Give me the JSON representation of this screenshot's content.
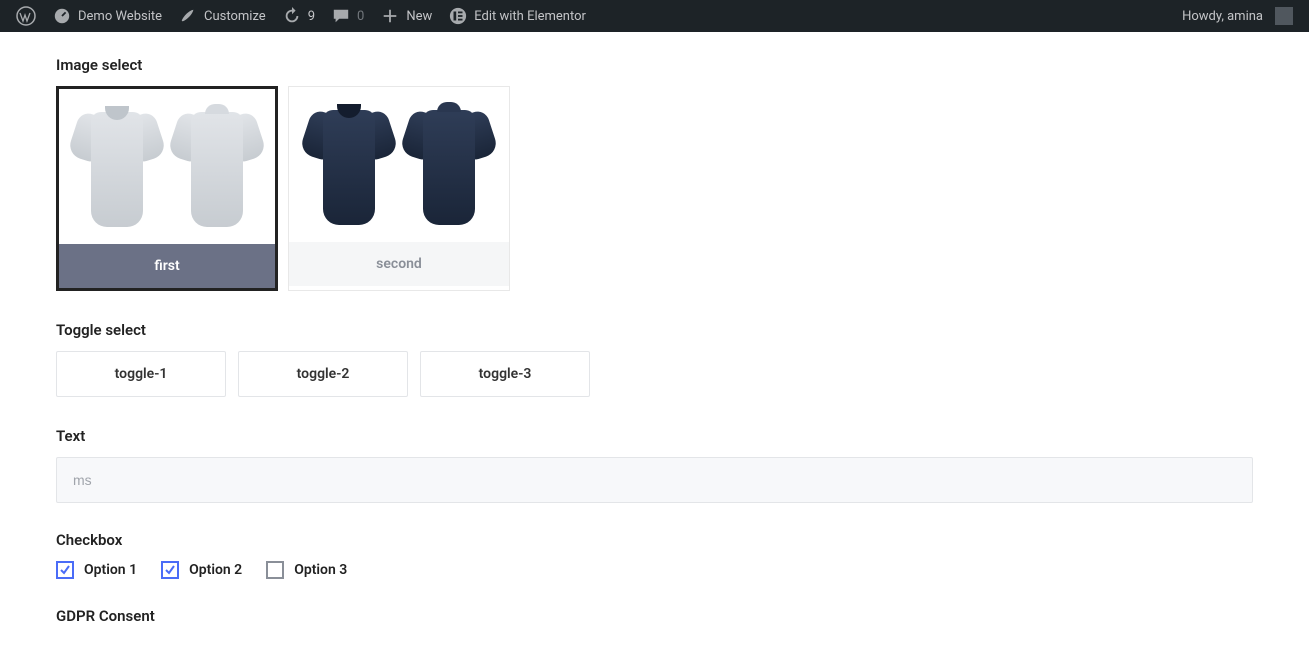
{
  "adminbar": {
    "site_name": "Demo Website",
    "customize": "Customize",
    "updates_count": "9",
    "comments_count": "0",
    "new": "New",
    "elementor": "Edit with Elementor",
    "howdy": "Howdy, amina"
  },
  "image_select": {
    "label": "Image select",
    "options": [
      {
        "caption": "first",
        "selected": true,
        "color": "grey"
      },
      {
        "caption": "second",
        "selected": false,
        "color": "navy"
      }
    ]
  },
  "toggle_select": {
    "label": "Toggle select",
    "options": [
      "toggle-1",
      "toggle-2",
      "toggle-3"
    ]
  },
  "text": {
    "label": "Text",
    "placeholder": "ms",
    "value": ""
  },
  "checkbox": {
    "label": "Checkbox",
    "options": [
      {
        "label": "Option 1",
        "checked": true
      },
      {
        "label": "Option 2",
        "checked": true
      },
      {
        "label": "Option 3",
        "checked": false
      }
    ]
  },
  "gdpr": {
    "label": "GDPR Consent"
  }
}
